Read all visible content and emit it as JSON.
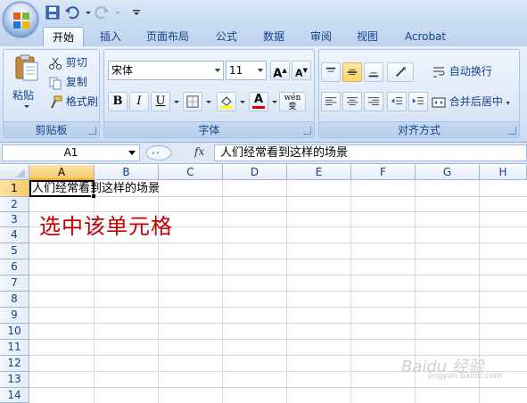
{
  "quick_access": [
    "save-icon",
    "undo-icon",
    "redo-icon",
    "customize-icon"
  ],
  "tabs": [
    {
      "label": "开始",
      "active": true
    },
    {
      "label": "插入"
    },
    {
      "label": "页面布局"
    },
    {
      "label": "公式"
    },
    {
      "label": "数据"
    },
    {
      "label": "审阅"
    },
    {
      "label": "视图"
    },
    {
      "label": "Acrobat"
    }
  ],
  "ribbon": {
    "clipboard": {
      "label": "剪贴板",
      "paste": "粘贴",
      "cut": "剪切",
      "copy": "复制",
      "format_painter": "格式刷"
    },
    "font": {
      "label": "字体",
      "font_name": "宋体",
      "font_size": "11",
      "grow": "A",
      "shrink": "A",
      "bold": "B",
      "italic": "I",
      "underline": "U",
      "font_color_letter": "A",
      "phonetic": "wén 变"
    },
    "alignment": {
      "label": "对齐方式",
      "wrap_text": "自动换行",
      "merge_center": "合并后居中"
    }
  },
  "formula_bar": {
    "name_box": "A1",
    "fx": "fx",
    "formula": "人们经常看到这样的场景"
  },
  "grid": {
    "columns": [
      "A",
      "B",
      "C",
      "D",
      "E",
      "F",
      "G",
      "H"
    ],
    "rows": [
      "1",
      "2",
      "3",
      "4",
      "5",
      "6",
      "7",
      "8",
      "9",
      "10",
      "11",
      "12",
      "13",
      "14"
    ],
    "selected_cell": "A1",
    "cell_a1": "人们经常看到这样的场景"
  },
  "annotation": "选中该单元格",
  "watermark": {
    "text": "Baidu 经验",
    "sub": "jingyan.baidu.com"
  },
  "colors": {
    "accent": "#15428b",
    "annotation": "#c00000",
    "selection": "#f9c868"
  }
}
